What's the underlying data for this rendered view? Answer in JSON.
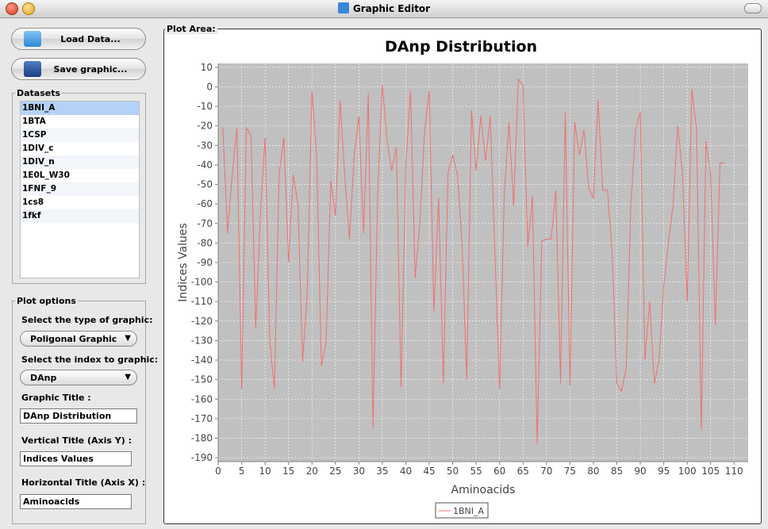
{
  "window": {
    "title": "Graphic Editor"
  },
  "toolbar": {
    "load_label": "Load Data...",
    "save_label": "Save graphic..."
  },
  "datasets": {
    "title": "Datasets",
    "items": [
      "1BNI_A",
      "1BTA",
      "1CSP",
      "1DIV_c",
      "1DIV_n",
      "1E0L_W30",
      "1FNF_9",
      "1cs8",
      "1fkf"
    ],
    "selected": "1BNI_A"
  },
  "plot_options": {
    "title": "Plot options",
    "type_label": "Select the type of graphic:",
    "type_value": "Poligonal Graphic",
    "index_label": "Select the index to graphic:",
    "index_value": "DAnp",
    "graphic_title_label": "Graphic Title :",
    "graphic_title_value": "DAnp Distribution",
    "vertical_title_label": "Vertical Title (Axis Y) :",
    "vertical_title_value": "Indices Values",
    "horizontal_title_label": "Horizontal Title (Axis X) :",
    "horizontal_title_value": "Aminoacids"
  },
  "plot_area": {
    "title": "Plot Area:"
  },
  "colors": {
    "series": "#f07070",
    "plot_bg": "#c0c0c0",
    "selection": "#b4d2f7"
  },
  "chart_data": {
    "type": "line",
    "title": "DAnp Distribution",
    "xlabel": "Aminoacids",
    "ylabel": "Indices Values",
    "xlim": [
      0,
      113
    ],
    "ylim": [
      -192,
      12
    ],
    "xticks": [
      0,
      5,
      10,
      15,
      20,
      25,
      30,
      35,
      40,
      45,
      50,
      55,
      60,
      65,
      70,
      75,
      80,
      85,
      90,
      95,
      100,
      105,
      110
    ],
    "yticks": [
      10,
      0,
      -10,
      -20,
      -30,
      -40,
      -50,
      -60,
      -70,
      -80,
      -90,
      -100,
      -110,
      -120,
      -130,
      -140,
      -150,
      -160,
      -170,
      -180,
      -190
    ],
    "grid": true,
    "legend": "bottom-center",
    "series": [
      {
        "name": "1BNI_A",
        "x": [
          1,
          2,
          3,
          4,
          5,
          6,
          7,
          8,
          9,
          10,
          11,
          12,
          13,
          14,
          15,
          16,
          17,
          18,
          19,
          20,
          21,
          22,
          23,
          24,
          25,
          26,
          27,
          28,
          29,
          30,
          31,
          32,
          33,
          34,
          35,
          36,
          37,
          38,
          39,
          40,
          41,
          42,
          43,
          44,
          45,
          46,
          47,
          48,
          49,
          50,
          51,
          52,
          53,
          54,
          55,
          56,
          57,
          58,
          59,
          60,
          61,
          62,
          63,
          64,
          65,
          66,
          67,
          68,
          69,
          70,
          71,
          72,
          73,
          74,
          75,
          76,
          77,
          78,
          79,
          80,
          81,
          82,
          83,
          84,
          85,
          86,
          87,
          88,
          89,
          90,
          91,
          92,
          93,
          94,
          95,
          96,
          97,
          98,
          99,
          100,
          101,
          102,
          103,
          104,
          105,
          106,
          107,
          108
        ],
        "y": [
          -21,
          -75,
          -45,
          -21,
          -155,
          -21,
          -25,
          -124,
          -65,
          -26,
          -130,
          -155,
          -45,
          -26,
          -90,
          -45,
          -60,
          -141,
          -105,
          -2,
          -35,
          -143,
          -131,
          -48,
          -66,
          -7,
          -46,
          -78,
          -35,
          -15,
          -75,
          -3,
          -175,
          -55,
          1,
          -27,
          -43,
          -31,
          -154,
          -40,
          -2,
          -98,
          -70,
          -23,
          -2,
          -115,
          -57,
          -152,
          -44,
          -35,
          -45,
          -80,
          -150,
          -12,
          -43,
          -15,
          -38,
          -15,
          -85,
          -155,
          -55,
          -18,
          -61,
          4,
          1,
          -82,
          -56,
          -183,
          -79,
          -78,
          -78,
          -53,
          -152,
          -13,
          -153,
          -18,
          -35,
          -22,
          -52,
          -57,
          -7,
          -53,
          -53,
          -85,
          -152,
          -156,
          -144,
          -60,
          -22,
          -13,
          -140,
          -110,
          -152,
          -140,
          -102,
          -80,
          -60,
          -20,
          -44,
          -110,
          -1,
          -22,
          -176,
          -28,
          -45,
          -122,
          -39,
          -39
        ]
      }
    ]
  }
}
